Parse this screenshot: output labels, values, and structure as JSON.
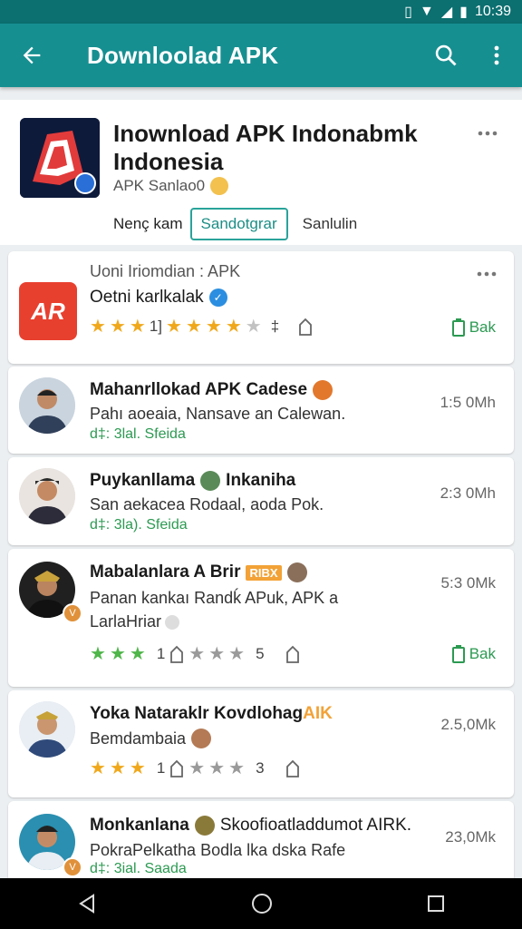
{
  "status_bar": {
    "time": "10:39"
  },
  "app_bar": {
    "title": "Downloolad APK"
  },
  "hero": {
    "title": "Inownload APK Indonabmk Indonesia",
    "subtitle": "APK Sanlao0",
    "seg_left": "Nenç kam",
    "seg_selected": "Sandotgrar",
    "seg_right": "Sanlulin"
  },
  "featured": {
    "heading": "Uoni Iriomdian : APK",
    "subtitle": "Oetni karlkalak",
    "icon_text": "AR",
    "rating_count_a": "1]",
    "rating_count_b": "‡",
    "download_label": "Bak"
  },
  "items": [
    {
      "name": "Mahanrllokad APK  Cadese",
      "desc": "Pahı aoeaia, Nansave an Calewan.",
      "meta": "d‡: 3lal. Sfeida",
      "size": "1:5 0Mh"
    },
    {
      "name": "Puykanllama",
      "name_tail": "Inkaniha",
      "desc": "San aekacea Rodaal, aoda Pok.",
      "meta": "d‡: 3la). Sfeida",
      "size": "2:3 0Mh"
    },
    {
      "name": "Mabalanlara A Brir",
      "tag": "RIBX",
      "desc": "Panan kankaı Randḱ APuk, APK a",
      "desc2": "LarlaHriar",
      "rating_a": "1",
      "rating_b": "5",
      "size": "5:3 0Mk",
      "download_label": "Bak"
    },
    {
      "name": "Yoka Nataraklr Kovdlohag",
      "name_accent": "AIK",
      "desc": "Bemdambaia",
      "rating_a": "1",
      "rating_b": "3",
      "size": "2.5,0Mk"
    },
    {
      "name": "Monkanlana",
      "name_tail": "Skoofioatladdumot AIRK.",
      "desc": "PokraPelkatha Bodla lka dska Rafe",
      "meta": "d‡: 3ial. Saada",
      "size": "23,0Mk"
    }
  ],
  "colors": {
    "primary": "#168f91",
    "status_bar": "#0c6f70",
    "green": "#2c9a52",
    "star": "#f0a81b"
  }
}
